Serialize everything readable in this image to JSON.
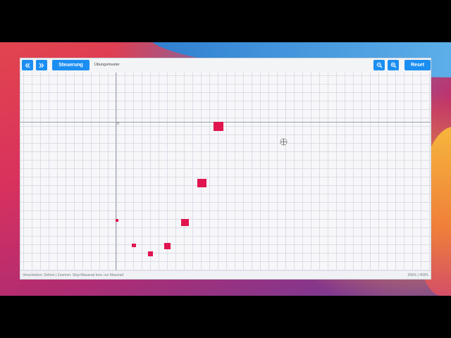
{
  "toolbar": {
    "back_icon": "double-chevron-left",
    "forward_icon": "double-chevron-right",
    "control_label": "Steuerung",
    "title": "Übungsmuster",
    "zoom_out_icon": "zoom-out-icon",
    "zoom_in_icon": "zoom-in-icon",
    "reset_label": "Reset",
    "accent_color": "#1b8ef2"
  },
  "canvas": {
    "origin_label": "0",
    "marker_color": "#e0144f",
    "grid": true
  },
  "status": {
    "hint": "Verschieben: Ziehen | Zoomen: Strg+Mausrad bzw. nur Mausrad",
    "zoom_readout": "256% | 403%"
  }
}
